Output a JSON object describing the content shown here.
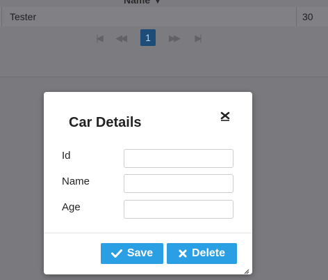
{
  "table": {
    "header_label": "Name",
    "sort_icon": "sort-down-icon",
    "row": {
      "name": "Tester",
      "age": "30"
    }
  },
  "pager": {
    "current_page": "1",
    "icons": [
      "first-page-icon",
      "previous-page-icon",
      "next-page-icon",
      "last-page-icon"
    ]
  },
  "dialog": {
    "title": "Car Details",
    "close_icon": "close-icon",
    "fields": [
      {
        "label": "Id",
        "value": ""
      },
      {
        "label": "Name",
        "value": ""
      },
      {
        "label": "Age",
        "value": ""
      }
    ],
    "buttons": {
      "save": {
        "label": "Save",
        "icon": "check-icon"
      },
      "delete": {
        "label": "Delete",
        "icon": "x-icon"
      }
    }
  },
  "colors": {
    "overlay": "#7a7a7e",
    "button_bg": "#2a9fe3",
    "active_page_bg": "#1c4c77"
  }
}
